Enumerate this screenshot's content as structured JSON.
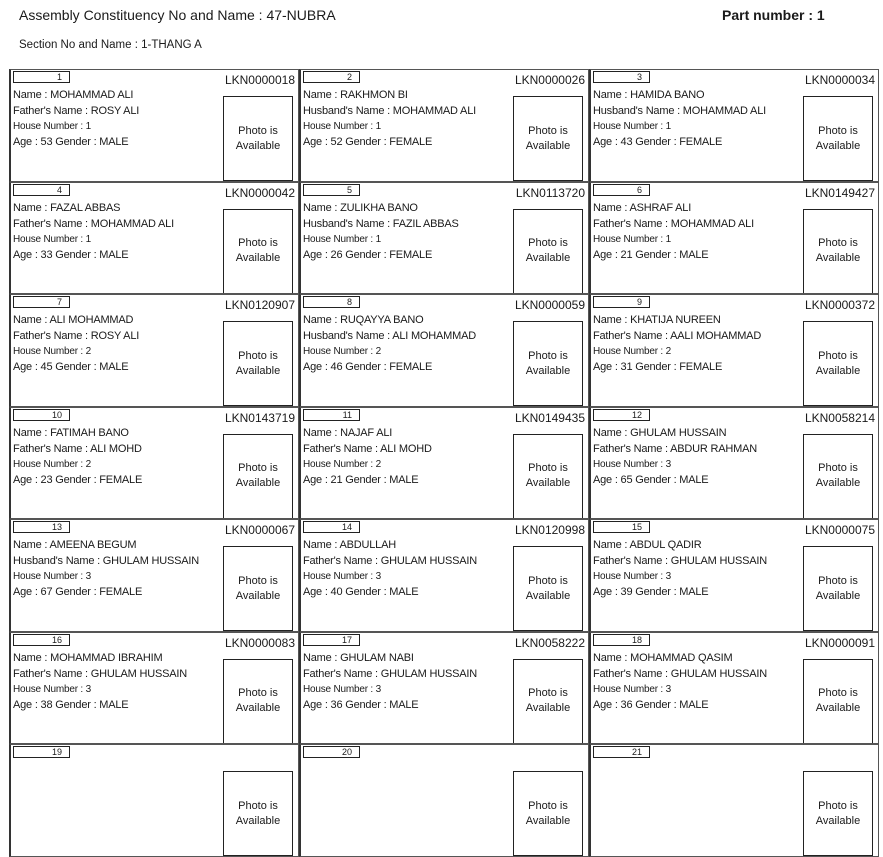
{
  "header": {
    "constituency": "Assembly Constituency No and Name : 47-NUBRA",
    "part": "Part number : 1",
    "section": "Section No and Name : 1-THANG A"
  },
  "photo_text": "Photo is Available",
  "voters": [
    {
      "serial": "1",
      "epic": "LKN0000018",
      "name": "Name : MOHAMMAD ALI",
      "relation": "Father's Name : ROSY ALI",
      "house": "House Number : 1",
      "age_gender": "Age : 53  Gender : MALE"
    },
    {
      "serial": "2",
      "epic": "LKN0000026",
      "name": "Name : RAKHMON BI",
      "relation": "Husband's Name : MOHAMMAD ALI",
      "house": "House Number : 1",
      "age_gender": "Age : 52  Gender : FEMALE"
    },
    {
      "serial": "3",
      "epic": "LKN0000034",
      "name": "Name : HAMIDA BANO",
      "relation": "Husband's Name : MOHAMMAD ALI",
      "house": "House Number : 1",
      "age_gender": "Age : 43  Gender : FEMALE"
    },
    {
      "serial": "4",
      "epic": "LKN0000042",
      "name": "Name : FAZAL ABBAS",
      "relation": "Father's Name : MOHAMMAD ALI",
      "house": "House Number : 1",
      "age_gender": "Age : 33  Gender : MALE"
    },
    {
      "serial": "5",
      "epic": "LKN0113720",
      "name": "Name : ZULIKHA BANO",
      "relation": "Husband's Name : FAZIL ABBAS",
      "house": "House Number : 1",
      "age_gender": "Age : 26  Gender : FEMALE"
    },
    {
      "serial": "6",
      "epic": "LKN0149427",
      "name": "Name : ASHRAF ALI",
      "relation": "Father's Name : MOHAMMAD ALI",
      "house": "House Number : 1",
      "age_gender": "Age : 21  Gender : MALE"
    },
    {
      "serial": "7",
      "epic": "LKN0120907",
      "name": "Name : ALI MOHAMMAD",
      "relation": "Father's Name : ROSY ALI",
      "house": "House Number : 2",
      "age_gender": "Age : 45  Gender : MALE"
    },
    {
      "serial": "8",
      "epic": "LKN0000059",
      "name": "Name : RUQAYYA BANO",
      "relation": "Husband's Name : ALI MOHAMMAD",
      "house": "House Number : 2",
      "age_gender": "Age : 46  Gender : FEMALE"
    },
    {
      "serial": "9",
      "epic": "LKN0000372",
      "name": "Name : KHATIJA NUREEN",
      "relation": "Father's Name : AALI MOHAMMAD",
      "house": "House Number : 2",
      "age_gender": "Age : 31  Gender : FEMALE"
    },
    {
      "serial": "10",
      "epic": "LKN0143719",
      "name": "Name : FATIMAH BANO",
      "relation": "Father's Name : ALI MOHD",
      "house": "House Number : 2",
      "age_gender": "Age : 23  Gender : FEMALE"
    },
    {
      "serial": "11",
      "epic": "LKN0149435",
      "name": "Name : NAJAF ALI",
      "relation": "Father's Name : ALI MOHD",
      "house": "House Number : 2",
      "age_gender": "Age : 21  Gender : MALE"
    },
    {
      "serial": "12",
      "epic": "LKN0058214",
      "name": "Name : GHULAM HUSSAIN",
      "relation": "Father's Name : ABDUR RAHMAN",
      "house": "House Number : 3",
      "age_gender": "Age : 65  Gender : MALE"
    },
    {
      "serial": "13",
      "epic": "LKN0000067",
      "name": "Name : AMEENA BEGUM",
      "relation": "Husband's Name : GHULAM HUSSAIN",
      "house": "House Number : 3",
      "age_gender": "Age : 67  Gender : FEMALE"
    },
    {
      "serial": "14",
      "epic": "LKN0120998",
      "name": "Name : ABDULLAH",
      "relation": "Father's Name : GHULAM HUSSAIN",
      "house": "House Number : 3",
      "age_gender": "Age : 40  Gender : MALE"
    },
    {
      "serial": "15",
      "epic": "LKN0000075",
      "name": "Name : ABDUL QADIR",
      "relation": "Father's Name : GHULAM HUSSAIN",
      "house": "House Number : 3",
      "age_gender": "Age : 39  Gender : MALE"
    },
    {
      "serial": "16",
      "epic": "LKN0000083",
      "name": "Name : MOHAMMAD IBRAHIM",
      "relation": "Father's Name : GHULAM HUSSAIN",
      "house": "House Number : 3",
      "age_gender": "Age : 38  Gender : MALE"
    },
    {
      "serial": "17",
      "epic": "LKN0058222",
      "name": "Name : GHULAM NABI",
      "relation": "Father's Name : GHULAM HUSSAIN",
      "house": "House Number : 3",
      "age_gender": "Age : 36  Gender : MALE"
    },
    {
      "serial": "18",
      "epic": "LKN0000091",
      "name": "Name : MOHAMMAD QASIM",
      "relation": "Father's Name : GHULAM HUSSAIN",
      "house": "House Number : 3",
      "age_gender": "Age : 36  Gender : MALE"
    },
    {
      "serial": "19",
      "epic": "",
      "name": "",
      "relation": "",
      "house": "",
      "age_gender": ""
    },
    {
      "serial": "20",
      "epic": "",
      "name": "",
      "relation": "",
      "house": "",
      "age_gender": ""
    },
    {
      "serial": "21",
      "epic": "",
      "name": "",
      "relation": "",
      "house": "",
      "age_gender": ""
    }
  ]
}
